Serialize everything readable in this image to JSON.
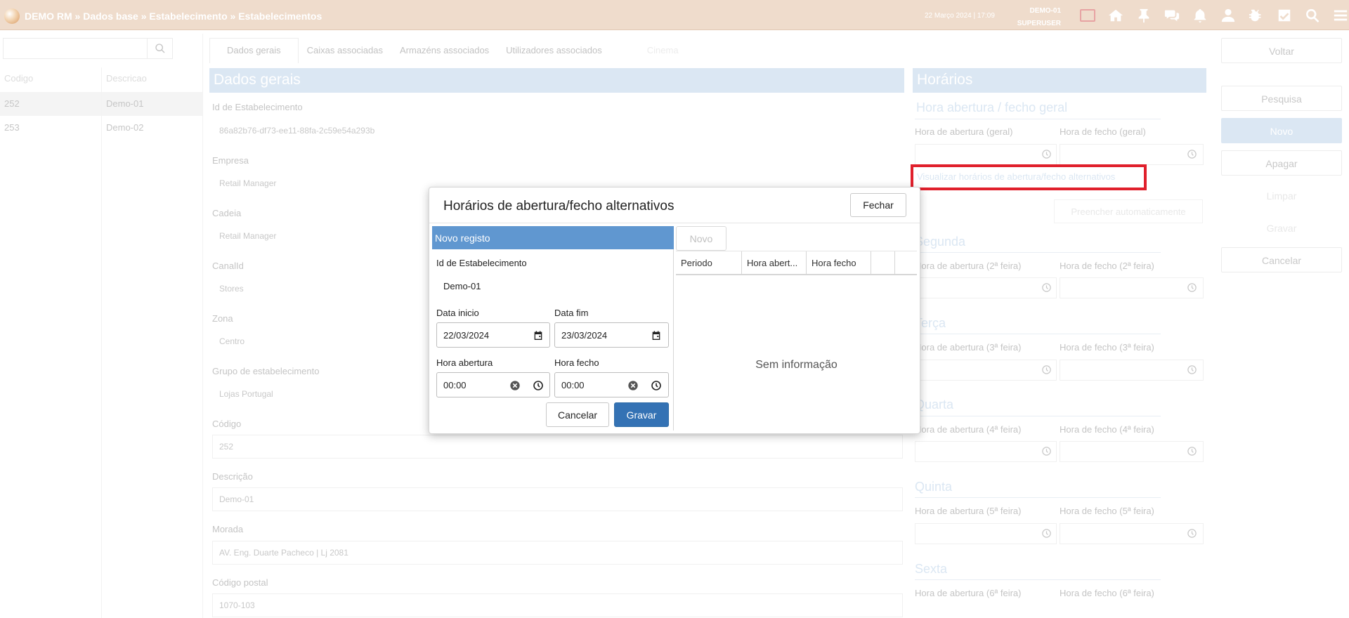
{
  "header": {
    "breadcrumb": "DEMO RM » Dados base » Estabelecimento » Estabelecimentos",
    "datetime": "22 Março 2024 | 17:09",
    "store": "DEMO-01",
    "user": "SUPERUSER",
    "icons": [
      "chat-box-icon",
      "home-icon",
      "pin-icon",
      "chat-icon",
      "bell-icon",
      "user-icon",
      "bug-icon",
      "check-icon",
      "search-icon",
      "menu-icon"
    ]
  },
  "left_list": {
    "search_placeholder": "",
    "columns": [
      "Codigo",
      "Descricao"
    ],
    "rows": [
      {
        "code": "252",
        "desc": "Demo-01"
      },
      {
        "code": "253",
        "desc": "Demo-02"
      }
    ]
  },
  "tabs": [
    "Dados gerais",
    "Caixas associadas",
    "Armazéns associados",
    "Utilizadores associados",
    "Cinema"
  ],
  "general": {
    "section_title": "Dados gerais",
    "fields": [
      {
        "label": "Id de Estabelecimento",
        "value": "86a82b76-df73-ee11-88fa-2c59e54a293b"
      },
      {
        "label": "Empresa",
        "value": "Retail Manager"
      },
      {
        "label": "Cadeia",
        "value": "Retail Manager"
      },
      {
        "label": "CanalId",
        "value": "Stores"
      },
      {
        "label": "Zona",
        "value": "Centro"
      },
      {
        "label": "Grupo de estabelecimento",
        "value": "Lojas Portugal"
      },
      {
        "label": "Código",
        "value": "252"
      },
      {
        "label": "Descrição",
        "value": "Demo-01"
      },
      {
        "label": "Morada",
        "value": "AV. Eng. Duarte Pacheco | Lj 2081"
      },
      {
        "label": "Código postal",
        "value": "1070-103"
      }
    ]
  },
  "schedule": {
    "section_title": "Horários",
    "general_title": "Hora abertura / fecho geral",
    "open_general": "Hora de abertura (geral)",
    "close_general": "Hora de fecho (geral)",
    "alt_link": "Visualizar horários de abertura/fecho alternativos",
    "auto_fill": "Preencher automaticamente",
    "days": [
      {
        "title": "Segunda",
        "open": "Hora de abertura (2ª feira)",
        "close": "Hora de fecho (2ª feira)"
      },
      {
        "title": "Terça",
        "open": "Hora de abertura (3ª feira)",
        "close": "Hora de fecho (3ª feira)"
      },
      {
        "title": "Quarta",
        "open": "Hora de abertura (4ª feira)",
        "close": "Hora de fecho (4ª feira)"
      },
      {
        "title": "Quinta",
        "open": "Hora de abertura (5ª feira)",
        "close": "Hora de fecho (5ª feira)"
      },
      {
        "title": "Sexta",
        "open": "Hora de abertura (6ª feira)",
        "close": "Hora de fecho (6ª feira)"
      }
    ]
  },
  "actions": {
    "back": "Voltar",
    "search": "Pesquisa",
    "new": "Novo",
    "delete": "Apagar",
    "clear": "Limpar",
    "save": "Gravar",
    "cancel": "Cancelar"
  },
  "modal": {
    "title": "Horários de abertura/fecho alternativos",
    "close": "Fechar",
    "new_record": "Novo registo",
    "store_id_label": "Id de Estabelecimento",
    "store_id_value": "Demo-01",
    "start_date_label": "Data inicio",
    "start_date_value": "22/03/2024",
    "end_date_label": "Data fim",
    "end_date_value": "23/03/2024",
    "open_hour_label": "Hora abertura",
    "open_hour_value": "00:00",
    "close_hour_label": "Hora fecho",
    "close_hour_value": "00:00",
    "cancel": "Cancelar",
    "save": "Gravar",
    "grid_new": "Novo",
    "grid_columns": [
      "Periodo",
      "Hora abert...",
      "Hora fecho",
      ""
    ],
    "no_info": "Sem informação"
  }
}
